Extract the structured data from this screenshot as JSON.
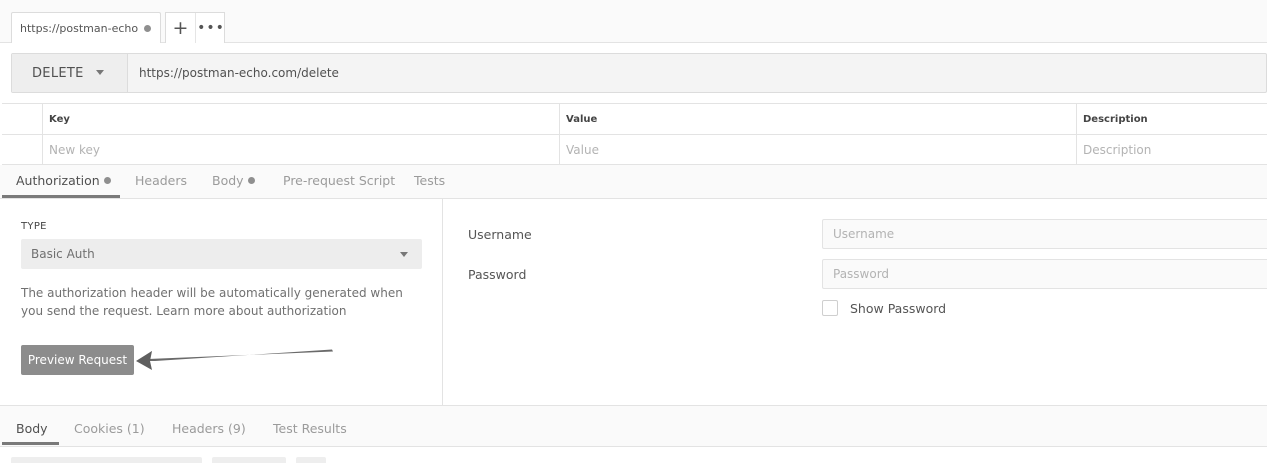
{
  "tab": {
    "title": "https://postman-echo",
    "plus_icon": "plus-icon",
    "more_icon": "more-icon",
    "plus_glyph": "+",
    "more_glyph": "•••"
  },
  "request": {
    "method": "DELETE",
    "url": "https://postman-echo.com/delete"
  },
  "params": {
    "headers": [
      "Key",
      "Value",
      "Description"
    ],
    "placeholders": {
      "key": "New key",
      "value": "Value",
      "description": "Description"
    }
  },
  "subtabs": [
    {
      "label": "Authorization",
      "active": true,
      "dot": true
    },
    {
      "label": "Headers",
      "active": false,
      "dot": false
    },
    {
      "label": "Body",
      "active": false,
      "dot": true
    },
    {
      "label": "Pre-request Script",
      "active": false,
      "dot": false
    },
    {
      "label": "Tests",
      "active": false,
      "dot": false
    }
  ],
  "auth": {
    "type_label": "TYPE",
    "type_value": "Basic Auth",
    "help_text": "The authorization header will be automatically generated when you send the request. Learn more about authorization",
    "preview_label": "Preview Request",
    "username_label": "Username",
    "username_placeholder": "Username",
    "password_label": "Password",
    "password_placeholder": "Password",
    "show_password_label": "Show Password"
  },
  "response_tabs": [
    {
      "label": "Body",
      "active": true
    },
    {
      "label": "Cookies (1)",
      "active": false
    },
    {
      "label": "Headers (9)",
      "active": false
    },
    {
      "label": "Test Results",
      "active": false
    }
  ],
  "colors": {
    "accent": "#7a7a7a",
    "button": "#8c8c8c",
    "annotation_arrow": "#6a6a6a"
  }
}
